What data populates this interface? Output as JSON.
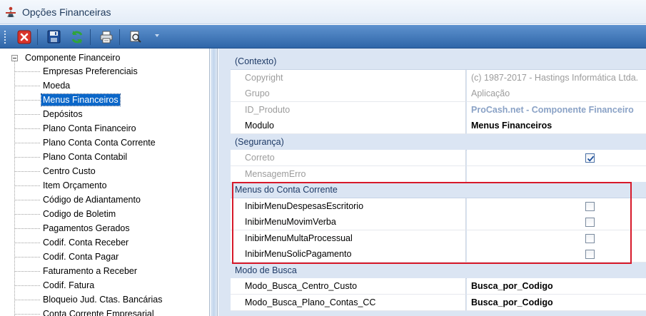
{
  "window": {
    "title": "Opções Financeiras"
  },
  "toolbar": {
    "buttons": [
      "close-icon",
      "save-icon",
      "refresh-icon",
      "print-icon",
      "search-icon"
    ]
  },
  "tree": {
    "root": "Componente Financeiro",
    "items": [
      "Empresas Preferenciais",
      "Moeda",
      "Menus Financeiros",
      "Depósitos",
      "Plano Conta Financeiro",
      "Plano Conta Conta Corrente",
      "Plano Conta Contabil",
      "Centro Custo",
      "Item Orçamento",
      "Código de Adiantamento",
      "Codigo de Boletim",
      "Pagamentos Gerados",
      "Codif. Conta Receber",
      "Codif. Conta Pagar",
      "Faturamento a Receber",
      "Codif. Fatura",
      "Bloqueio Jud. Ctas. Bancárias",
      "Conta Corrente Empresarial"
    ],
    "selected_index": 2
  },
  "grid": {
    "categories": {
      "contexto": "(Contexto)",
      "seguranca": "(Segurança)",
      "menus": "Menus do Conta Corrente",
      "busca": "Modo de Busca"
    },
    "contexto": [
      {
        "name": "Copyright",
        "value": "(c) 1987-2017 - Hastings Informática Ltda."
      },
      {
        "name": "Grupo",
        "value": "Aplicação"
      },
      {
        "name": "ID_Produto",
        "value": "ProCash.net - Componente Financeiro"
      },
      {
        "name": "Modulo",
        "value": "Menus Financeiros"
      }
    ],
    "seguranca": [
      {
        "name": "Correto",
        "checked": true
      },
      {
        "name": "MensagemErro",
        "value": ""
      }
    ],
    "menus": [
      {
        "name": "InibirMenuDespesasEscritorio",
        "checked": false
      },
      {
        "name": "InibirMenuMovimVerba",
        "checked": false
      },
      {
        "name": "InibirMenuMultaProcessual",
        "checked": false
      },
      {
        "name": "InibirMenuSolicPagamento",
        "checked": false
      }
    ],
    "busca": [
      {
        "name": "Modo_Busca_Centro_Custo",
        "value": "Busca_por_Codigo"
      },
      {
        "name": "Modo_Busca_Plano_Contas_CC",
        "value": "Busca_por_Codigo"
      }
    ]
  },
  "colors": {
    "toolbar": "#2f66a8",
    "selection": "#0b67c9",
    "category_bg": "#dbe5f3",
    "highlight_box": "#d7192a"
  }
}
